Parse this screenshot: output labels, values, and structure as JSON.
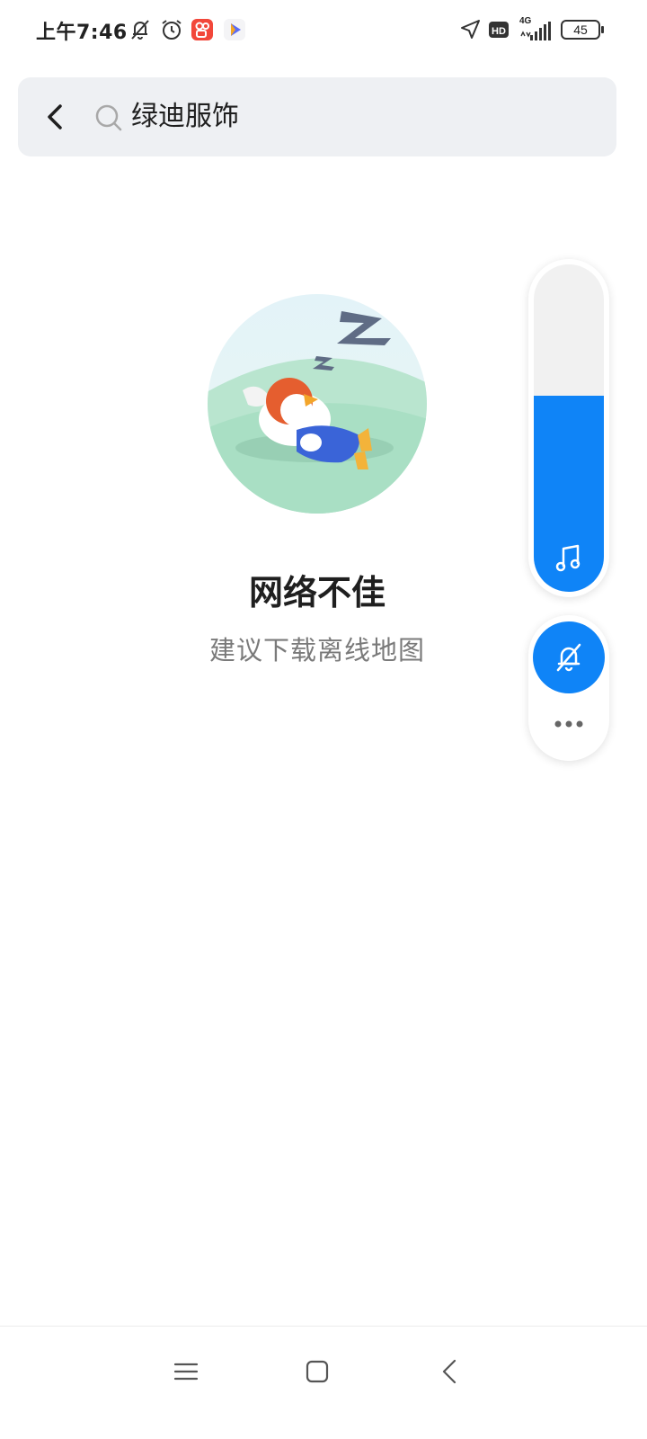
{
  "status_bar": {
    "time": "上午7:46",
    "network": "4G",
    "hd_badge": "HD",
    "battery": "45",
    "icons": [
      "mute-bell-icon",
      "alarm-icon",
      "kuaishou-app-icon",
      "video-app-icon",
      "location-arrow-icon",
      "hd-icon",
      "signal-icon",
      "battery-icon"
    ]
  },
  "search": {
    "query": "绿迪服饰",
    "back_icon": "back-arrow-icon",
    "search_icon": "search-icon"
  },
  "error": {
    "title": "网络不佳",
    "subtitle": "建议下载离线地图",
    "illustration": "sleeping-penguin-illustration"
  },
  "volume_panel": {
    "level": 0.6,
    "accent": "#0f84f7",
    "icons": [
      "music-note-icon",
      "bell-muted-icon",
      "more-dots-icon"
    ]
  },
  "nav_bar": {
    "icons": [
      "menu-icon",
      "home-icon",
      "back-icon"
    ]
  }
}
